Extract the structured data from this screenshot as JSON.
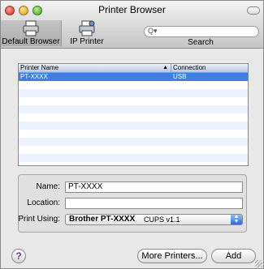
{
  "window": {
    "title": "Printer Browser"
  },
  "toolbar": {
    "default_browser_label": "Default Browser",
    "ip_printer_label": "IP Printer",
    "search_label": "Search",
    "search_placeholder": ""
  },
  "printer_list": {
    "columns": [
      "Printer Name",
      "Connection"
    ],
    "rows": [
      {
        "name": "PT-XXXX",
        "connection": "USB",
        "selected": true
      }
    ]
  },
  "details": {
    "name_label": "Name:",
    "name_value": "PT-XXXX",
    "location_label": "Location:",
    "location_value": "",
    "print_using_label": "Print Using:",
    "print_using_value": "Brother PT-XXXX",
    "print_using_driver": "CUPS v1.1"
  },
  "buttons": {
    "help": "?",
    "more_printers": "More Printers...",
    "add": "Add"
  },
  "colors": {
    "selection": "#3d80df",
    "stripe": "#edf3fe"
  }
}
